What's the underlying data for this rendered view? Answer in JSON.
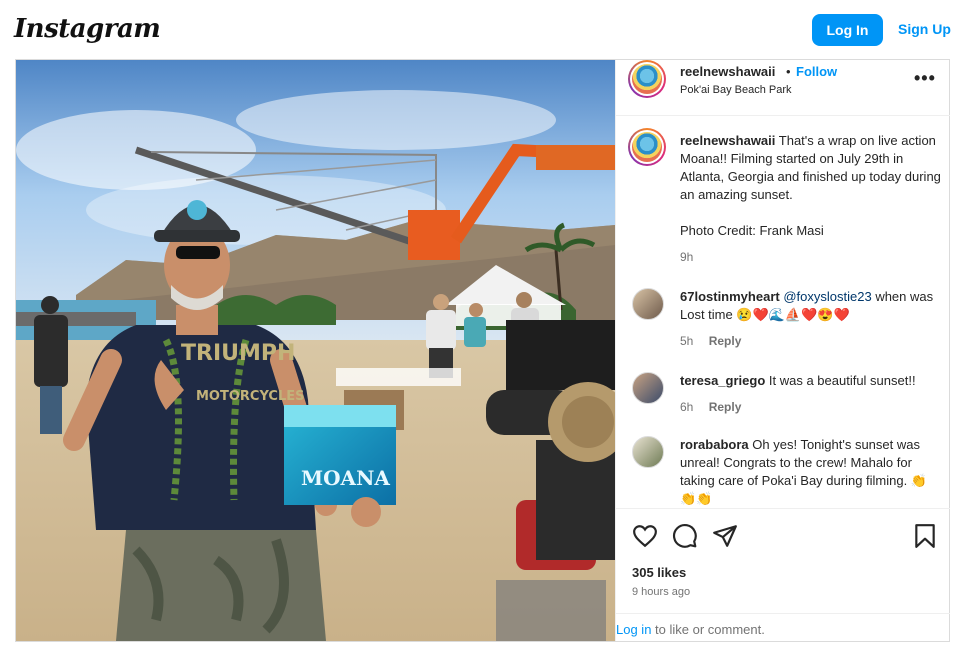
{
  "app": {
    "logo": "Instagram",
    "login_label": "Log In",
    "signup_label": "Sign Up",
    "accent": "#0095f6"
  },
  "post": {
    "username": "reelnewshawaii",
    "dot": "•",
    "follow_label": "Follow",
    "location": "Pok'ai Bay Beach Park",
    "caption": {
      "username": "reelnewshawaii",
      "text": "That's a wrap on live action Moana!! Filming started on July 29th in Atlanta, Georgia and finished up today during an amazing sunset.",
      "credit": "Photo Credit: Frank Masi",
      "time": "9h"
    },
    "comments": [
      {
        "username": "67lostinmyheart",
        "mention": "@foxyslostie23",
        "text": "when was Lost time 😢❤️🌊⛵❤️😍❤️",
        "time": "5h",
        "reply_label": "Reply"
      },
      {
        "username": "teresa_griego",
        "mention": "",
        "text": "It was a beautiful sunset!!",
        "time": "6h",
        "reply_label": "Reply"
      },
      {
        "username": "rorababora",
        "mention": "",
        "text": "Oh yes! Tonight's sunset was unreal! Congrats to the crew! Mahalo for taking care of Poka'i Bay during filming. 👏👏👏",
        "time": "",
        "reply_label": ""
      }
    ],
    "likes": "305 likes",
    "time_ago": "9 hours ago",
    "login_prompt": {
      "link": "Log in",
      "text": "to like or comment."
    },
    "icons": [
      "heart-icon",
      "comment-icon",
      "share-icon",
      "bookmark-icon",
      "more-icon"
    ],
    "photo_text": {
      "shirt": "TRIUMPH",
      "shirt_sub": "MOTORCYCLES",
      "clapper": "MOANA"
    }
  }
}
